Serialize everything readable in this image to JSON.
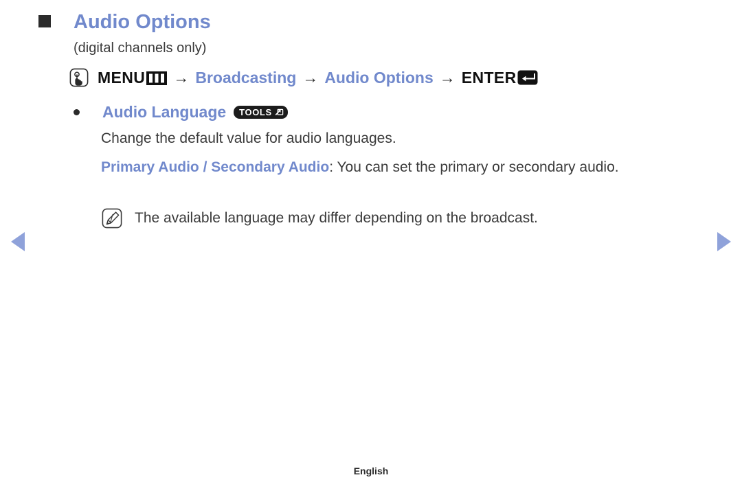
{
  "heading": {
    "bullet_icon": "filled-square-icon",
    "title": "Audio Options",
    "subtitle": "(digital channels only)"
  },
  "menu_path": {
    "remote_icon": "hand-press-icon",
    "step_menu": "MENU",
    "menu_glyph_icon": "menu-bars-icon",
    "arrow_1": "→",
    "step_broadcasting": "Broadcasting",
    "arrow_2": "→",
    "step_audio_options": "Audio Options",
    "arrow_3": "→",
    "step_enter": "ENTER",
    "enter_glyph_icon": "enter-return-icon"
  },
  "item": {
    "bullet_icon": "bullet-dot-icon",
    "label": "Audio Language",
    "tools_badge": "TOOLS",
    "tools_badge_icon": "tools-arrow-icon",
    "description": "Change the default value for audio languages.",
    "option_title": "Primary Audio / Secondary Audio",
    "option_body": ": You can set the primary or secondary audio."
  },
  "note": {
    "icon": "note-pencil-icon",
    "text": "The available language may differ depending on the broadcast."
  },
  "navigation": {
    "prev_icon": "prev-arrow-icon",
    "next_icon": "next-arrow-icon"
  },
  "footer": {
    "language": "English"
  },
  "colors": {
    "accent_blue": "#7189cc",
    "nav_arrow_blue": "#8fa2da",
    "text_dark": "#2b2b2b",
    "badge_black": "#1c1c1c"
  }
}
